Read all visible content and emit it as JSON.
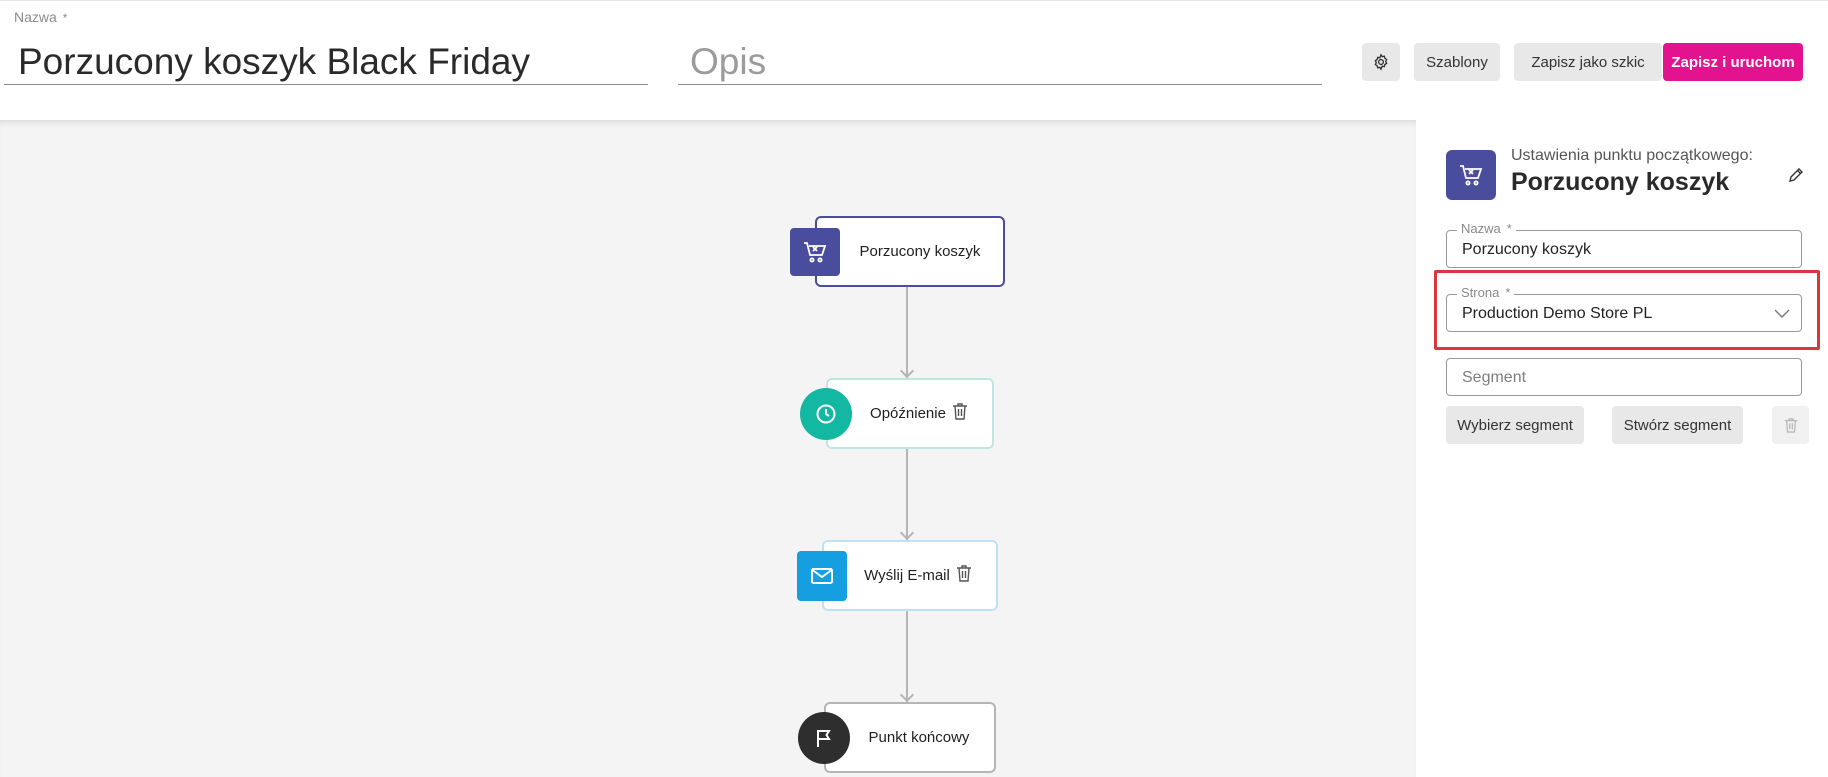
{
  "header": {
    "name_label": "Nazwa",
    "required_mark": "*",
    "name_value": "Porzucony koszyk Black Friday",
    "description_placeholder": "Opis",
    "templates_label": "Szablony",
    "save_draft_label": "Zapisz jako szkic",
    "save_run_label": "Zapisz i uruchom"
  },
  "flow": {
    "nodes": [
      {
        "label": "Porzucony koszyk",
        "icon": "abandoned-cart-icon",
        "color": "#4a4c9e"
      },
      {
        "label": "Opóźnienie",
        "icon": "clock-icon",
        "color": "#13b8a3"
      },
      {
        "label": "Wyślij E-mail",
        "icon": "envelope-icon",
        "color": "#159fe0"
      },
      {
        "label": "Punkt końcowy",
        "icon": "flag-icon",
        "color": "#2e2e2e"
      }
    ]
  },
  "panel": {
    "subtitle": "Ustawienia punktu początkowego:",
    "title": "Porzucony koszyk",
    "name_label": "Nazwa",
    "name_value": "Porzucony koszyk",
    "site_label": "Strona",
    "site_value": "Production Demo Store PL",
    "segment_placeholder": "Segment",
    "choose_segment_label": "Wybierz segment",
    "create_segment_label": "Stwórz segment"
  },
  "colors": {
    "primary": "#e3138f",
    "highlight": "#d9363e",
    "start_node": "#4a4c9e"
  }
}
